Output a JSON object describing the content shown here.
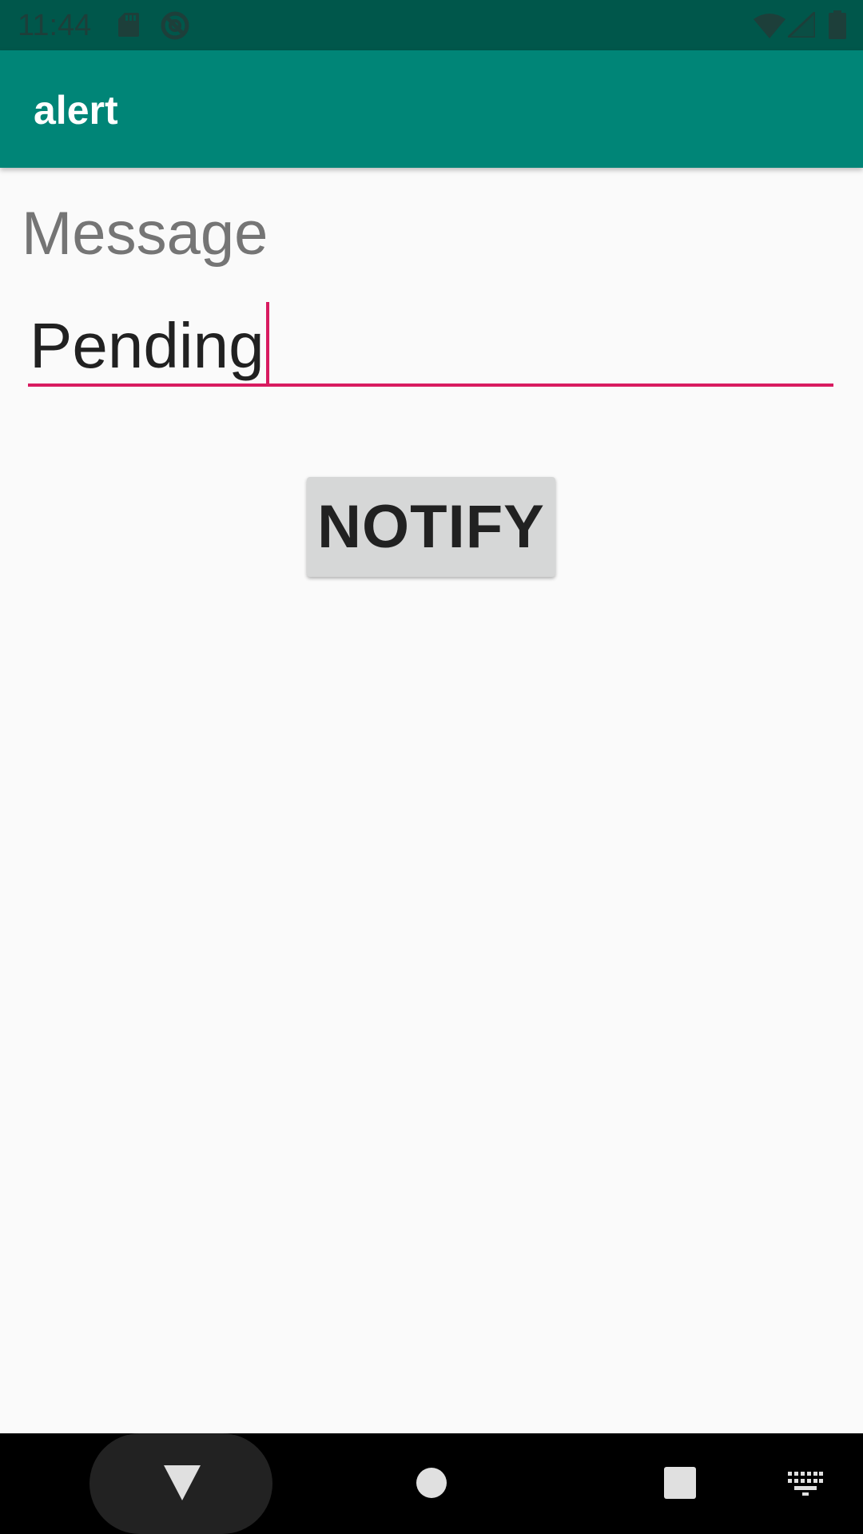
{
  "status_bar": {
    "time": "11:44",
    "icons": [
      "sd-card-icon",
      "sync-disabled-icon",
      "wifi-icon",
      "cellular-signal-icon",
      "battery-icon"
    ]
  },
  "app_bar": {
    "title": "alert"
  },
  "message_field": {
    "label": "Message",
    "value": "Pending",
    "focused": true
  },
  "notify_button": {
    "label": "NOTIFY"
  },
  "nav_bar": {
    "icons": [
      "back-icon",
      "home-icon",
      "recents-icon",
      "keyboard-icon"
    ]
  },
  "colors": {
    "status_bar": "#00574b",
    "app_bar": "#008577",
    "accent": "#d81b60",
    "background": "#fafafa",
    "button": "#d6d7d7"
  }
}
